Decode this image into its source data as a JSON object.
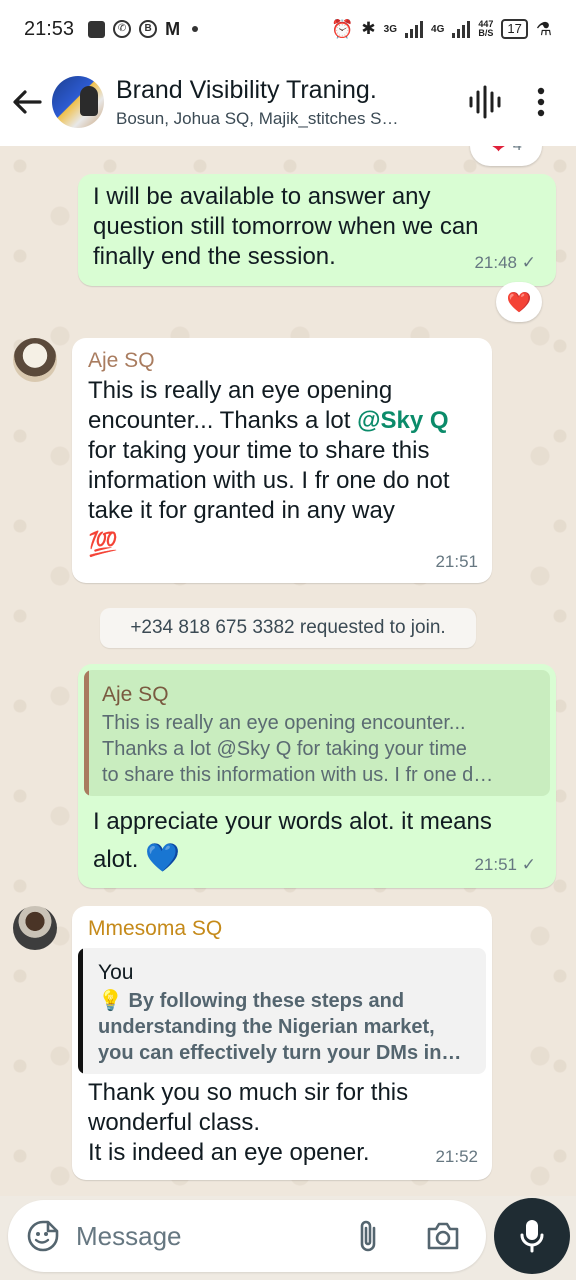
{
  "status_bar": {
    "time": "21:53",
    "net_speed_value": "447",
    "net_speed_unit": "B/S",
    "battery": "17",
    "network_3g": "3G",
    "network_4g": "4G"
  },
  "header": {
    "title": "Brand Visibility Traning.",
    "subtitle": "Bosun, Johua SQ, Majik_stitches S…"
  },
  "messages": [
    {
      "id": "m1",
      "text": "I will be available to answer any question still tomorrow when we can finally end the session.",
      "lines": [
        "I will be available to answer any",
        "question still tomorrow when we can",
        "finally end the session."
      ],
      "time": "21:48",
      "reaction": "❤️"
    },
    {
      "id": "m2",
      "sender": "Aje SQ",
      "lines_before_mention": "This is really an eye opening encounter... Thanks a lot ",
      "mention": "@Sky Q",
      "lines_after_mention": "for taking your time to share this information with us. I fr one do not take it for granted in any way",
      "emoji": "💯",
      "time": "21:51"
    },
    {
      "id": "m3",
      "quote_sender": "Aje SQ",
      "quote_lines": [
        "This is really an eye opening encounter...",
        "Thanks a lot @Sky Q  for taking your time",
        "to share this information with us. I fr one d…"
      ],
      "lines": [
        "I appreciate your words alot. it means",
        "alot."
      ],
      "emoji": "💙",
      "time": "21:51"
    },
    {
      "id": "m4",
      "sender": "Mmesoma SQ",
      "quote_sender": "You",
      "quote_lines": [
        "💡 By following these steps and",
        "understanding the Nigerian market,",
        "you can effectively turn your DMs in…"
      ],
      "lines": [
        "Thank you so much sir for this",
        "wonderful class.",
        "It is indeed an eye opener."
      ],
      "time": "21:52"
    }
  ],
  "system_message": "+234 818 675 3382 requested to join.",
  "composer": {
    "placeholder": "Message"
  },
  "colors": {
    "outgoing_bubble": "#d9fdd3",
    "incoming_bubble": "#ffffff",
    "chat_background": "#efe7dc",
    "aje_sender": "#a97c5f",
    "mmesoma_sender": "#c58a1a",
    "mention": "#0b8b6a"
  }
}
